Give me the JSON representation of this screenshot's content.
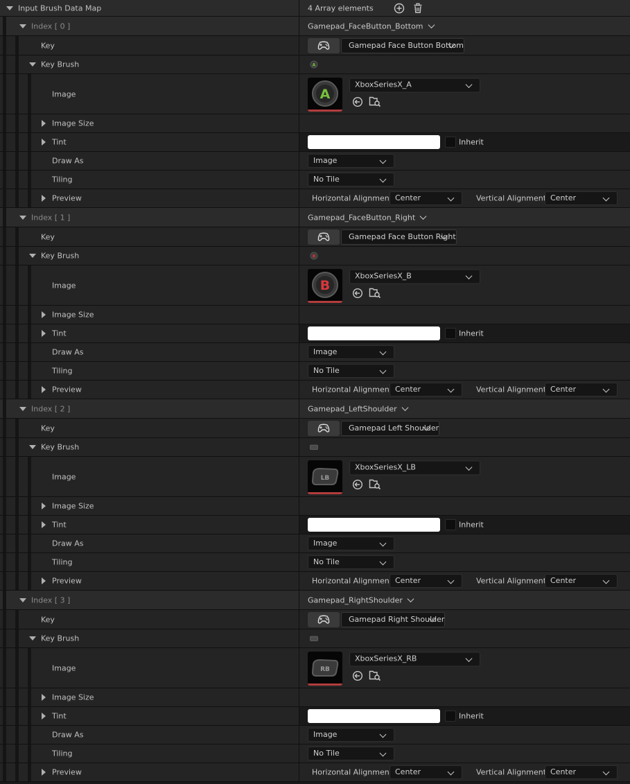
{
  "root": {
    "label": "Input Brush Data Map",
    "count": "4 Array elements",
    "icons": [
      "add-icon",
      "trash-icon"
    ]
  },
  "labels": {
    "key": "Key",
    "key_brush": "Key Brush",
    "image": "Image",
    "image_size": "Image Size",
    "tint": "Tint",
    "inherit": "Inherit",
    "draw_as": "Draw As",
    "tiling": "Tiling",
    "preview": "Preview",
    "horizontal_alignment": "Horizontal Alignment",
    "vertical_alignment": "Vertical Alignment"
  },
  "colors": {
    "tint": "#ffffff",
    "xbox_a": "#78c03c",
    "xbox_b": "#d8383c",
    "thumb_underline": "#b33c3c"
  },
  "elements": [
    {
      "index": "Index [ 0 ]",
      "key_name": "Gamepad_FaceButton_Bottom",
      "key_display": "Gamepad Face Button Bottom",
      "image_asset": "XboxSeriesX_A",
      "glyph": "A",
      "draw_as": "Image",
      "tiling": "No Tile",
      "h_align": "Center",
      "v_align": "Center"
    },
    {
      "index": "Index [ 1 ]",
      "key_name": "Gamepad_FaceButton_Right",
      "key_display": "Gamepad Face Button Right",
      "image_asset": "XboxSeriesX_B",
      "glyph": "B",
      "draw_as": "Image",
      "tiling": "No Tile",
      "h_align": "Center",
      "v_align": "Center"
    },
    {
      "index": "Index [ 2 ]",
      "key_name": "Gamepad_LeftShoulder",
      "key_display": "Gamepad Left Shoulder",
      "image_asset": "XboxSeriesX_LB",
      "glyph": "LB",
      "draw_as": "Image",
      "tiling": "No Tile",
      "h_align": "Center",
      "v_align": "Center"
    },
    {
      "index": "Index [ 3 ]",
      "key_name": "Gamepad_RightShoulder",
      "key_display": "Gamepad Right Shoulder",
      "image_asset": "XboxSeriesX_RB",
      "glyph": "RB",
      "draw_as": "Image",
      "tiling": "No Tile",
      "h_align": "Center",
      "v_align": "Center"
    }
  ]
}
